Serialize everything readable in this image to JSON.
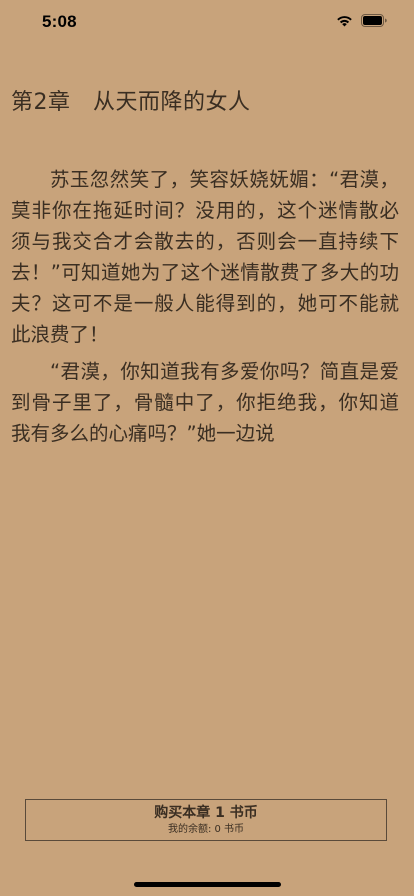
{
  "status_bar": {
    "time": "5:08",
    "icons": [
      "wifi-icon",
      "battery-icon"
    ]
  },
  "chapter": {
    "title": "第2章　从天而降的女人"
  },
  "content": {
    "paragraphs": [
      "苏玉忽然笑了，笑容妖娆妩媚：“君漠，莫非你在拖延时间？没用的，这个迷情散必须与我交合才会散去的，否则会一直持续下去！”可知道她为了这个迷情散费了多大的功夫？这可不是一般人能得到的，她可不能就此浪费了！",
      "“君漠，你知道我有多爱你吗？简直是爱到骨子里了，骨髓中了，你拒绝我，你知道我有多么的心痛吗？”她一边说"
    ]
  },
  "purchase": {
    "title": "购买本章 1 书币",
    "balance": "我的余额: 0 书币"
  },
  "colors": {
    "background": "#c8a37b",
    "text": "#3a2e22",
    "border": "#5a4a3a"
  }
}
